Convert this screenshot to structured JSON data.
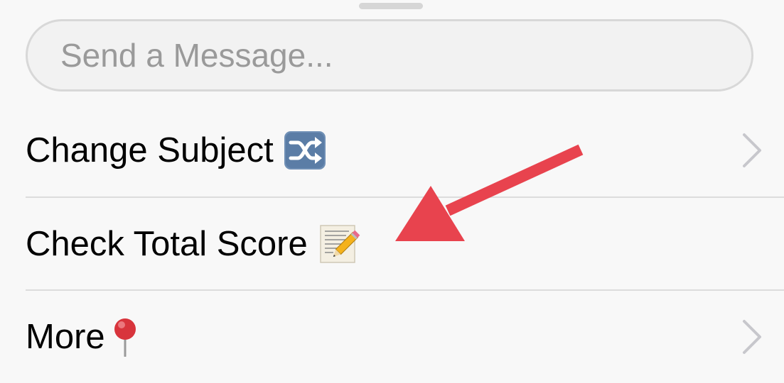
{
  "message": {
    "placeholder": "Send a Message..."
  },
  "menu": {
    "items": [
      {
        "label": "Change Subject",
        "emoji": "shuffle-icon",
        "has_chevron": true
      },
      {
        "label": "Check Total Score",
        "emoji": "memo-icon",
        "has_chevron": false
      },
      {
        "label": "More",
        "emoji": "pushpin-icon",
        "has_chevron": true
      }
    ]
  },
  "annotation": {
    "type": "arrow",
    "color": "#e8434e",
    "points_to": "Check Total Score"
  },
  "colors": {
    "background": "#f8f8f8",
    "input_border": "#d8d8d8",
    "separator": "#dcdcdc",
    "chevron": "#c7c7cc",
    "placeholder": "#9a9a9a"
  }
}
